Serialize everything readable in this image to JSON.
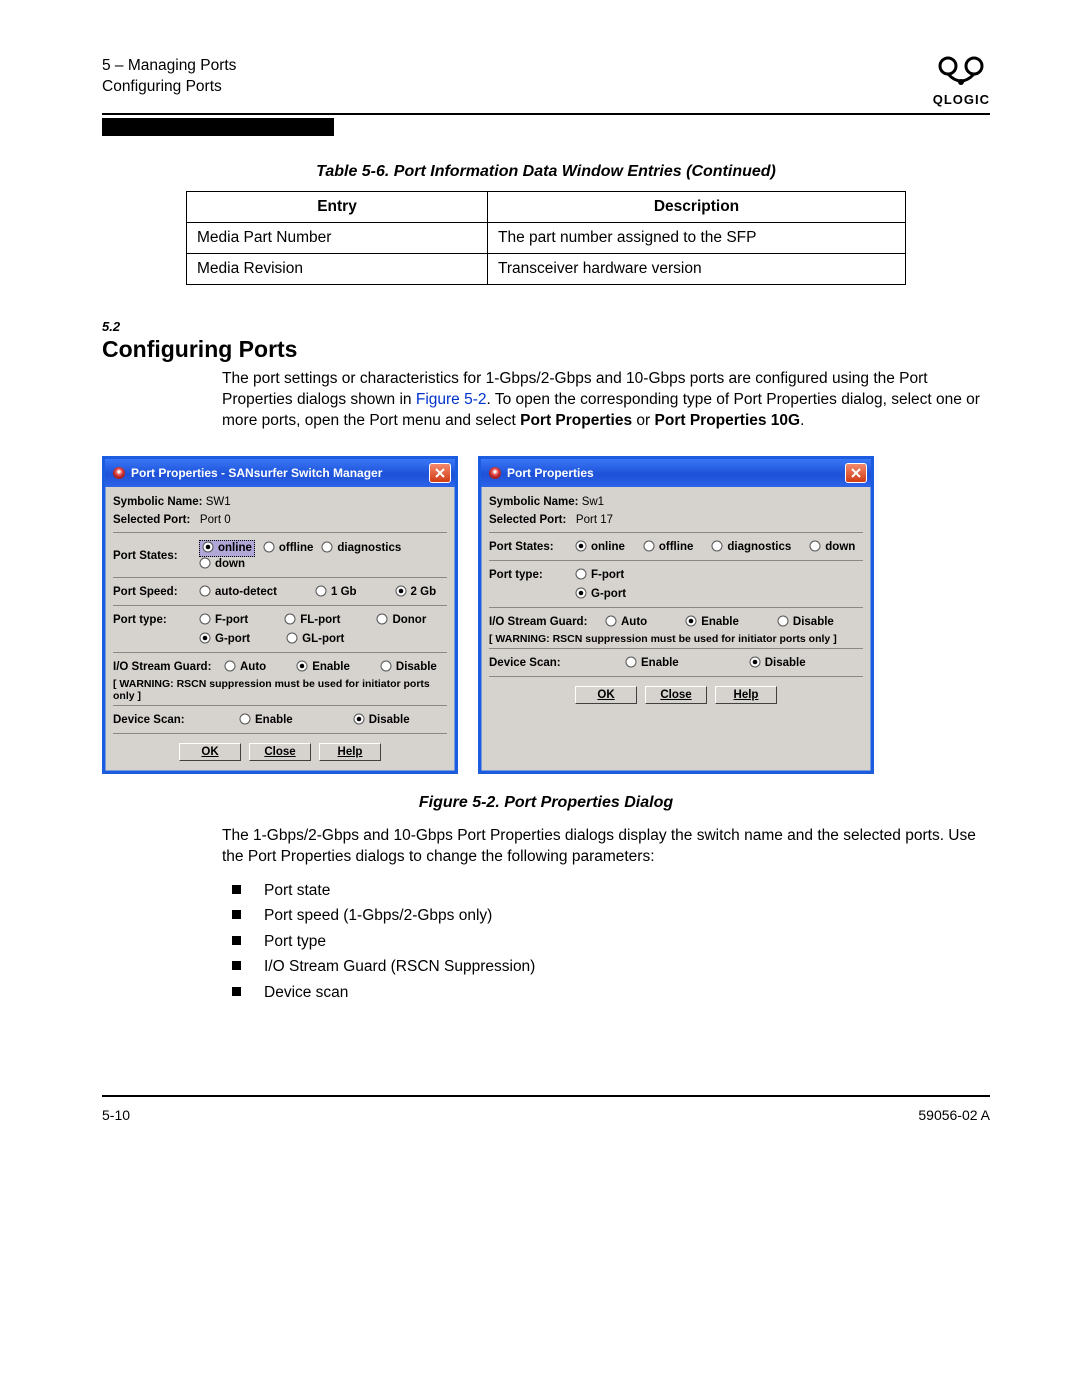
{
  "header": {
    "chapter": "5 – Managing Ports",
    "section": "Configuring Ports",
    "logo_text": "QLOGIC"
  },
  "table_caption": "Table 5-6. Port Information Data Window Entries  (Continued)",
  "table": {
    "headers": [
      "Entry",
      "Description"
    ],
    "rows": [
      {
        "entry": "Media Part Number",
        "desc": "The part number assigned to the SFP"
      },
      {
        "entry": "Media Revision",
        "desc": "Transceiver hardware version"
      }
    ]
  },
  "section_num": "5.2",
  "section_title": "Configuring Ports",
  "intro_parts": {
    "p1": "The port settings or characteristics for 1-Gbps/2-Gbps and 10-Gbps ports are configured using the Port Properties dialogs shown in ",
    "link": "Figure 5-2",
    "p2": ". To open the corresponding type of Port Properties dialog, select one or more ports, open the Port menu and select ",
    "b1": "Port Properties",
    "mid": " or ",
    "b2": "Port Properties 10G",
    "end": "."
  },
  "dialogA": {
    "title": "Port Properties - SANsurfer Switch Manager",
    "sym_name_lbl": "Symbolic Name:",
    "sym_name_val": "SW1",
    "sel_port_lbl": "Selected Port:",
    "sel_port_val": "Port 0",
    "states_lbl": "Port States:",
    "states": [
      {
        "label": "online",
        "selected": true,
        "highlight": true
      },
      {
        "label": "offline",
        "selected": false
      },
      {
        "label": "diagnostics",
        "selected": false
      },
      {
        "label": "down",
        "selected": false
      }
    ],
    "speed_lbl": "Port Speed:",
    "speeds": [
      {
        "label": "auto-detect",
        "selected": false
      },
      {
        "label": "1 Gb",
        "selected": false
      },
      {
        "label": "2 Gb",
        "selected": true
      }
    ],
    "type_lbl": "Port type:",
    "types_row1": [
      {
        "label": "F-port",
        "selected": false
      },
      {
        "label": "FL-port",
        "selected": false
      },
      {
        "label": "Donor",
        "selected": false
      }
    ],
    "types_row2": [
      {
        "label": "G-port",
        "selected": true
      },
      {
        "label": "GL-port",
        "selected": false
      }
    ],
    "iosg_lbl": "I/O Stream Guard:",
    "iosg": [
      {
        "label": "Auto",
        "selected": false
      },
      {
        "label": "Enable",
        "selected": true
      },
      {
        "label": "Disable",
        "selected": false
      }
    ],
    "warn": "[ WARNING: RSCN suppression must be used for initiator ports only ]",
    "devscan_lbl": "Device Scan:",
    "devscan": [
      {
        "label": "Enable",
        "selected": false
      },
      {
        "label": "Disable",
        "selected": true
      }
    ],
    "buttons": [
      "OK",
      "Close",
      "Help"
    ]
  },
  "dialogB": {
    "title": "Port Properties",
    "sym_name_lbl": "Symbolic Name:",
    "sym_name_val": "Sw1",
    "sel_port_lbl": "Selected Port:",
    "sel_port_val": "Port 17",
    "states_lbl": "Port States:",
    "states": [
      {
        "label": "online",
        "selected": true
      },
      {
        "label": "offline",
        "selected": false
      },
      {
        "label": "diagnostics",
        "selected": false
      },
      {
        "label": "down",
        "selected": false
      }
    ],
    "type_lbl": "Port type:",
    "types_row1": [
      {
        "label": "F-port",
        "selected": false
      }
    ],
    "types_row2": [
      {
        "label": "G-port",
        "selected": true
      }
    ],
    "iosg_lbl": "I/O Stream Guard:",
    "iosg": [
      {
        "label": "Auto",
        "selected": false
      },
      {
        "label": "Enable",
        "selected": true
      },
      {
        "label": "Disable",
        "selected": false
      }
    ],
    "warn": "[ WARNING: RSCN suppression must be used for initiator ports only ]",
    "devscan_lbl": "Device Scan:",
    "devscan": [
      {
        "label": "Enable",
        "selected": false
      },
      {
        "label": "Disable",
        "selected": true
      }
    ],
    "buttons": [
      "OK",
      "Close",
      "Help"
    ]
  },
  "fig_caption": "Figure 5-2.  Port Properties Dialog",
  "para2": "The 1-Gbps/2-Gbps and 10-Gbps Port Properties dialogs display the switch name and the selected ports. Use the Port Properties dialogs to change the following parameters:",
  "bullets": [
    "Port state",
    "Port speed (1-Gbps/2-Gbps only)",
    "Port type",
    "I/O Stream Guard (RSCN Suppression)",
    "Device scan"
  ],
  "footer": {
    "page": "5-10",
    "doc": "59056-02 A"
  }
}
